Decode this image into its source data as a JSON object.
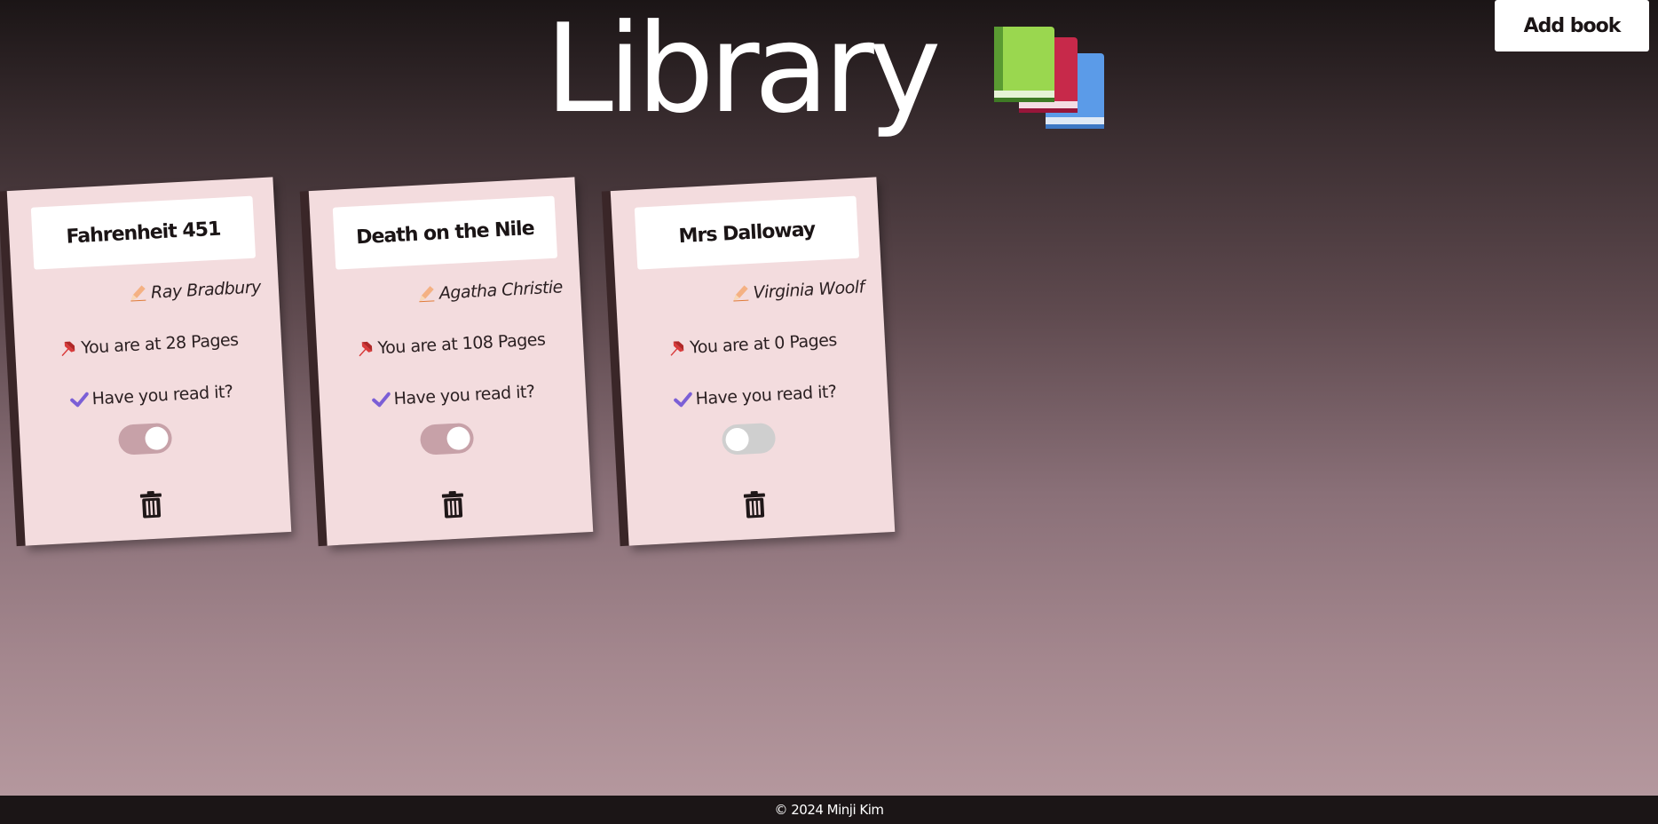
{
  "header": {
    "title": "Library",
    "add_book_label": "Add book"
  },
  "books": [
    {
      "title": "Fahrenheit 451",
      "author": "Ray Bradbury",
      "pages_text": "You are at 28 Pages",
      "pages": 28,
      "read_question": "Have you read it?",
      "read": true
    },
    {
      "title": "Death on the Nile",
      "author": "Agatha Christie",
      "pages_text": "You are at 108 Pages",
      "pages": 108,
      "read_question": "Have you read it?",
      "read": true
    },
    {
      "title": "Mrs Dalloway",
      "author": "Virginia Woolf",
      "pages_text": "You are at 0 Pages",
      "pages": 0,
      "read_question": "Have you read it?",
      "read": false
    }
  ],
  "footer": {
    "copyright": "© 2024 Minji Kim"
  },
  "icons": {
    "header": "books-icon",
    "author": "pencil-icon",
    "pages": "pushpin-icon",
    "read": "checkmark-icon",
    "delete": "trash-icon"
  },
  "colors": {
    "card_background": "#f3dcde",
    "toggle_on": "#c7a1a8",
    "toggle_off": "#cfcfcf",
    "checkmark": "#7b5fd6",
    "pushpin": "#d93a3a",
    "footer_background": "#1b1516"
  }
}
